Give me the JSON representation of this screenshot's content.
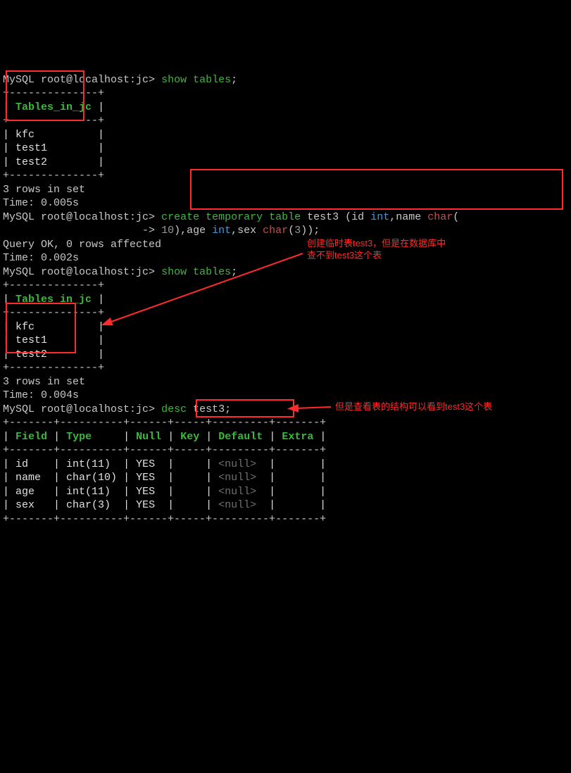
{
  "prompt": "MySQL root@localhost:jc>",
  "cont_prompt": "->",
  "cmd1": "show tables",
  "semi": ";",
  "tables_header": "Tables_in_jc",
  "tables_sep": "+--------------+",
  "tables": [
    "kfc",
    "test1",
    "test2"
  ],
  "rows_msg1": "3 rows in set",
  "time1": "Time: 0.005s",
  "cmd2_parts": {
    "p1": "create temporary table",
    "name": "test3",
    "open": "(id",
    "int": "int",
    "comma_name": ",name",
    "char": "char",
    "paren1": "(",
    "num10": "10",
    "close_age": "),age",
    "comma_sex": ",sex",
    "paren3": "(",
    "num3": "3",
    "close_all": "));"
  },
  "query_ok": "Query OK, 0 rows affected",
  "time2": "Time: 0.002s",
  "rows_msg2": "3 rows in set",
  "time3": "Time: 0.004s",
  "cmd3": "desc",
  "cmd3_arg": "test3",
  "desc_sep": "+-------+----------+------+-----+---------+-------+",
  "desc_headers": [
    "Field",
    "Type",
    "Null",
    "Key",
    "Default",
    "Extra"
  ],
  "desc_rows": [
    {
      "field": "id",
      "type": "int(11)",
      "null": "YES",
      "key": "",
      "default": "<null>",
      "extra": ""
    },
    {
      "field": "name",
      "type": "char(10)",
      "null": "YES",
      "key": "",
      "default": "<null>",
      "extra": ""
    },
    {
      "field": "age",
      "type": "int(11)",
      "null": "YES",
      "key": "",
      "default": "<null>",
      "extra": ""
    },
    {
      "field": "sex",
      "type": "char(3)",
      "null": "YES",
      "key": "",
      "default": "<null>",
      "extra": ""
    }
  ],
  "annot1_l1": "创建临时表test3，但是在数据库中",
  "annot1_l2": "查不到test3这个表",
  "annot2": "但是查看表的结构可以看到test3这个表"
}
